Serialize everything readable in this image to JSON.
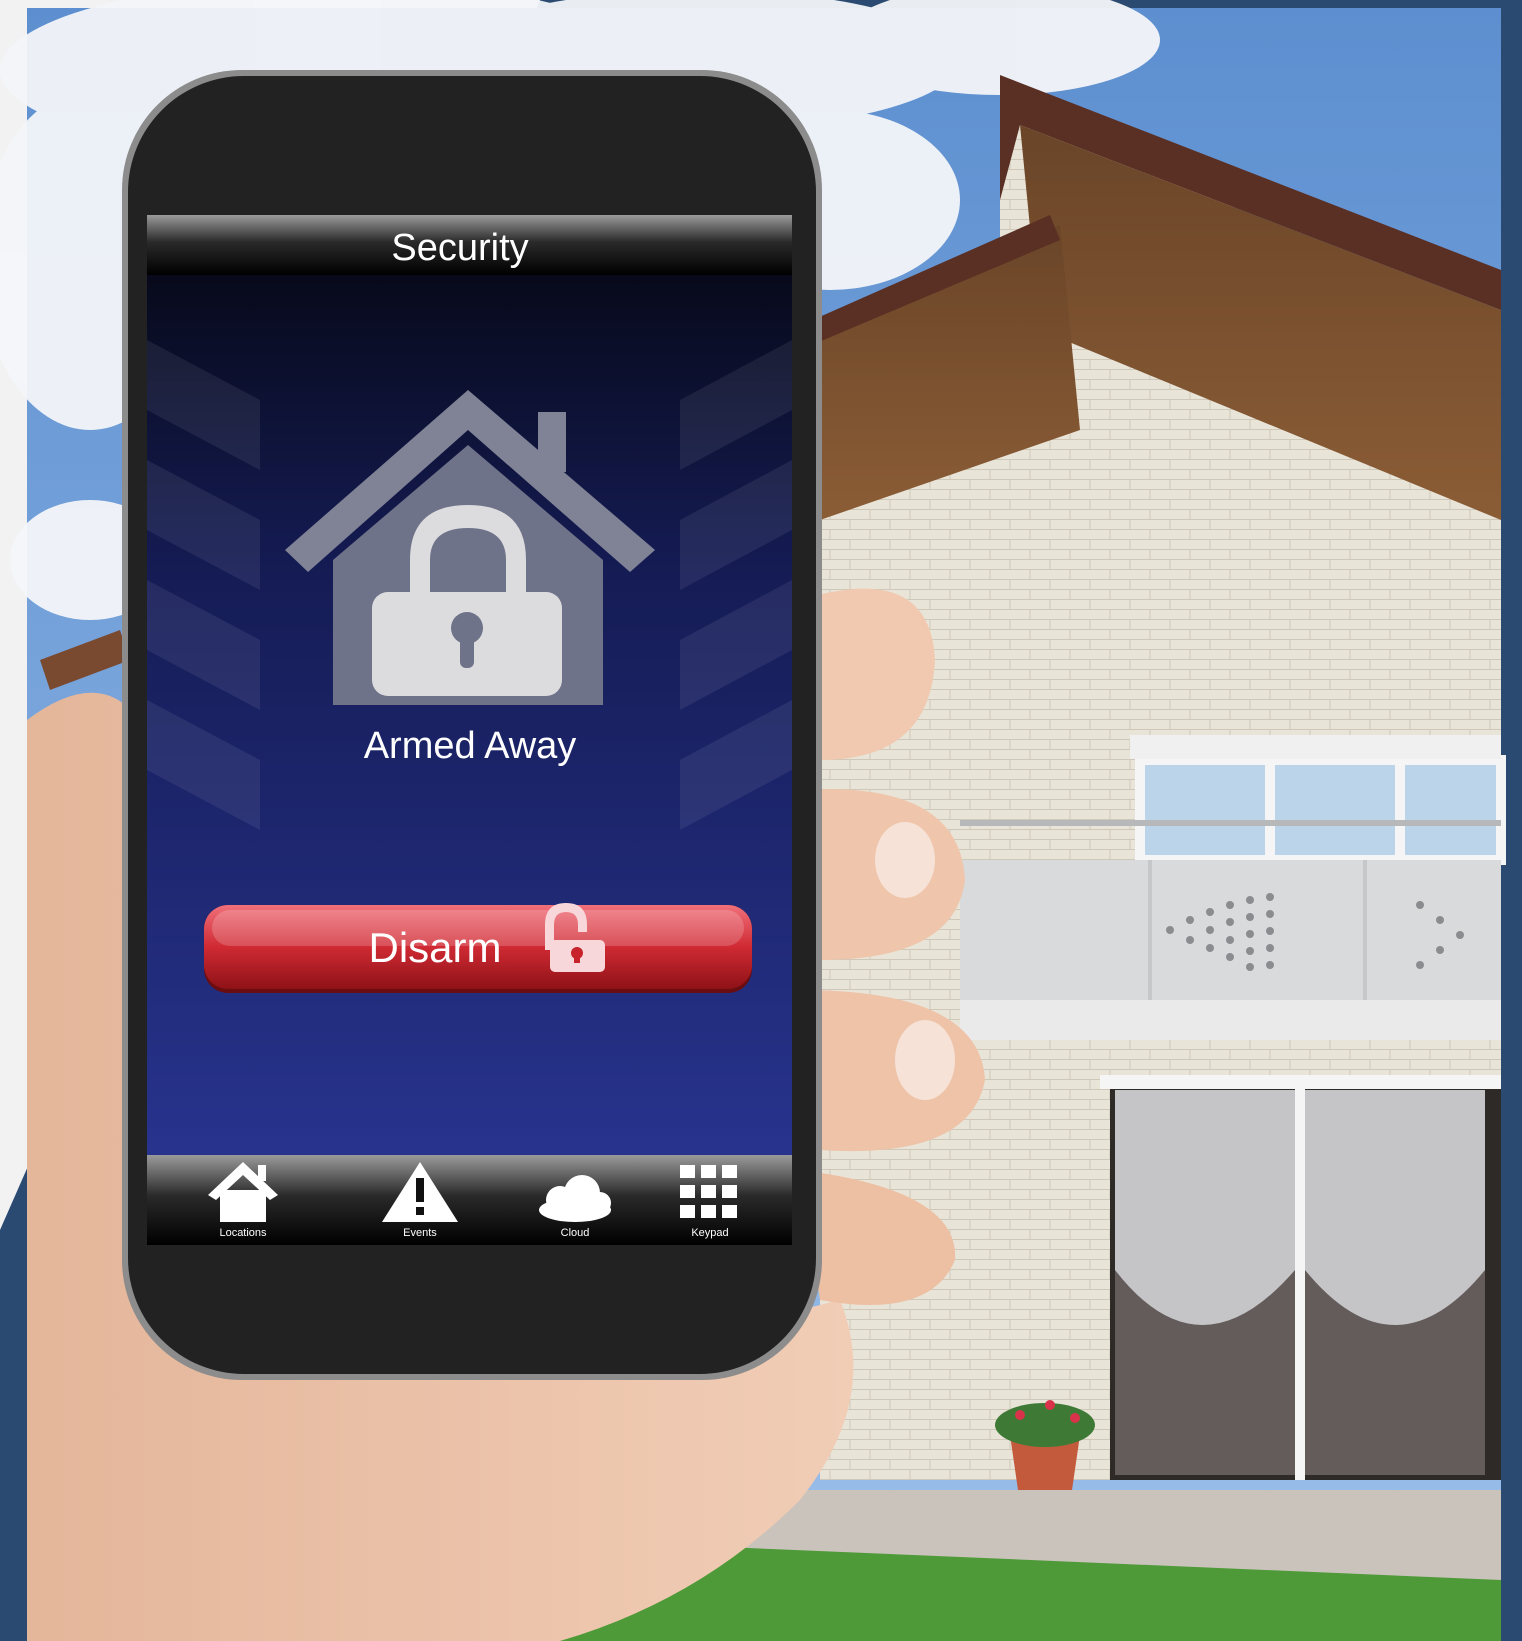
{
  "app": {
    "title": "Security",
    "status": "Armed Away",
    "disarm_label": "Disarm"
  },
  "tabs": [
    {
      "label": "Locations",
      "icon": "house-icon"
    },
    {
      "label": "Events",
      "icon": "warning-icon"
    },
    {
      "label": "Cloud",
      "icon": "cloud-icon"
    },
    {
      "label": "Keypad",
      "icon": "keypad-icon"
    }
  ],
  "colors": {
    "frame_accent": "#2b4a72",
    "screen_bg": "#1f2a7a",
    "disarm_button": "#c8222a"
  }
}
